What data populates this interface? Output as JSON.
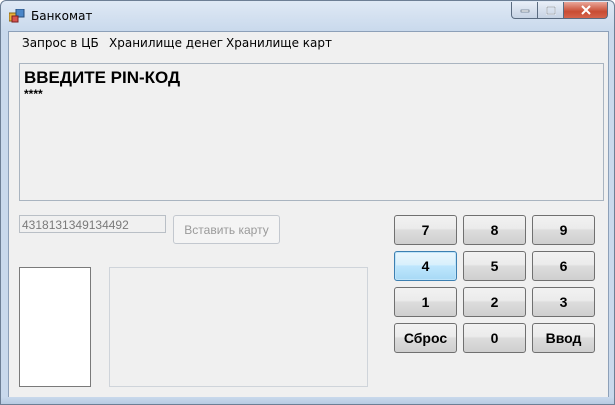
{
  "window": {
    "title": "Банкомат",
    "controls": {
      "minimize_icon": "minimize-icon",
      "maximize_icon": "maximize-icon",
      "close_icon": "close-icon"
    }
  },
  "menu": {
    "items": [
      {
        "label": "Запрос в ЦБ"
      },
      {
        "label": "Хранилище денег"
      },
      {
        "label": "Хранилище карт"
      }
    ]
  },
  "screen": {
    "message": "ВВЕДИТЕ PIN-КОД",
    "pin_mask": "****"
  },
  "card": {
    "number": "4318131349134492",
    "insert_label": "Вставить карту"
  },
  "keypad": {
    "keys": [
      "7",
      "8",
      "9",
      "4",
      "5",
      "6",
      "1",
      "2",
      "3",
      "Сброс",
      "0",
      "Ввод"
    ],
    "focused_key": "4"
  },
  "colors": {
    "close_button": "#c84c33",
    "focus_border": "#3c7fb1"
  }
}
